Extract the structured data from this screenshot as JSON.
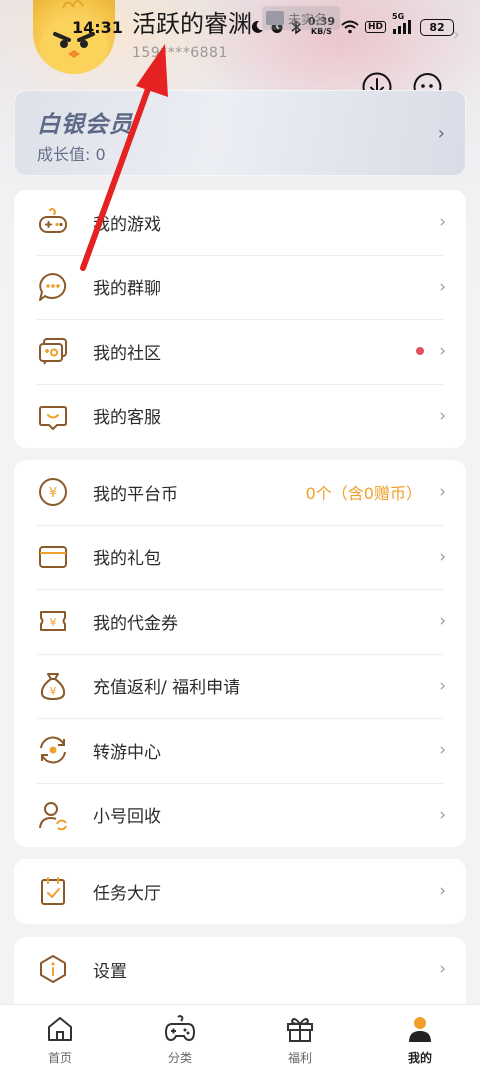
{
  "status_bar": {
    "time": "14:31",
    "net_speed_value": "0.39",
    "net_speed_unit": "KB/S",
    "hd_label": "HD",
    "signal_label": "5G",
    "battery": "82"
  },
  "profile": {
    "username": "活跃的睿渊",
    "realname_badge": "未实名",
    "phone": "159****6881"
  },
  "member": {
    "level": "白银会员",
    "growth": "成长值: 0"
  },
  "group_games": [
    {
      "label": "我的游戏",
      "icon": "gamepad-icon"
    },
    {
      "label": "我的群聊",
      "icon": "chat-bubble-icon"
    },
    {
      "label": "我的社区",
      "icon": "community-icon",
      "has_dot": true
    },
    {
      "label": "我的客服",
      "icon": "customer-service-icon"
    }
  ],
  "group_assets": [
    {
      "label": "我的平台币",
      "icon": "coin-icon",
      "extra": "0个（含0赠币）"
    },
    {
      "label": "我的礼包",
      "icon": "gift-pack-icon"
    },
    {
      "label": "我的代金券",
      "icon": "voucher-icon"
    },
    {
      "label": "充值返利/ 福利申请",
      "icon": "money-bag-icon"
    },
    {
      "label": "转游中心",
      "icon": "transfer-icon"
    },
    {
      "label": "小号回收",
      "icon": "account-recycle-icon"
    }
  ],
  "group_tasks": [
    {
      "label": "任务大厅",
      "icon": "task-clipboard-icon"
    }
  ],
  "group_settings": [
    {
      "label": "设置",
      "icon": "settings-info-icon"
    }
  ],
  "bottom_nav": [
    {
      "label": "首页",
      "icon": "home-icon"
    },
    {
      "label": "分类",
      "icon": "category-gamepad-icon"
    },
    {
      "label": "福利",
      "icon": "welfare-gift-icon"
    },
    {
      "label": "我的",
      "icon": "profile-icon",
      "active": true
    }
  ],
  "colors": {
    "accent": "#f0a02a",
    "icon_brown": "#8a5a2b",
    "member_text": "#5d6a86",
    "dot_red": "#e2525a",
    "arrow_red": "#e52222"
  }
}
